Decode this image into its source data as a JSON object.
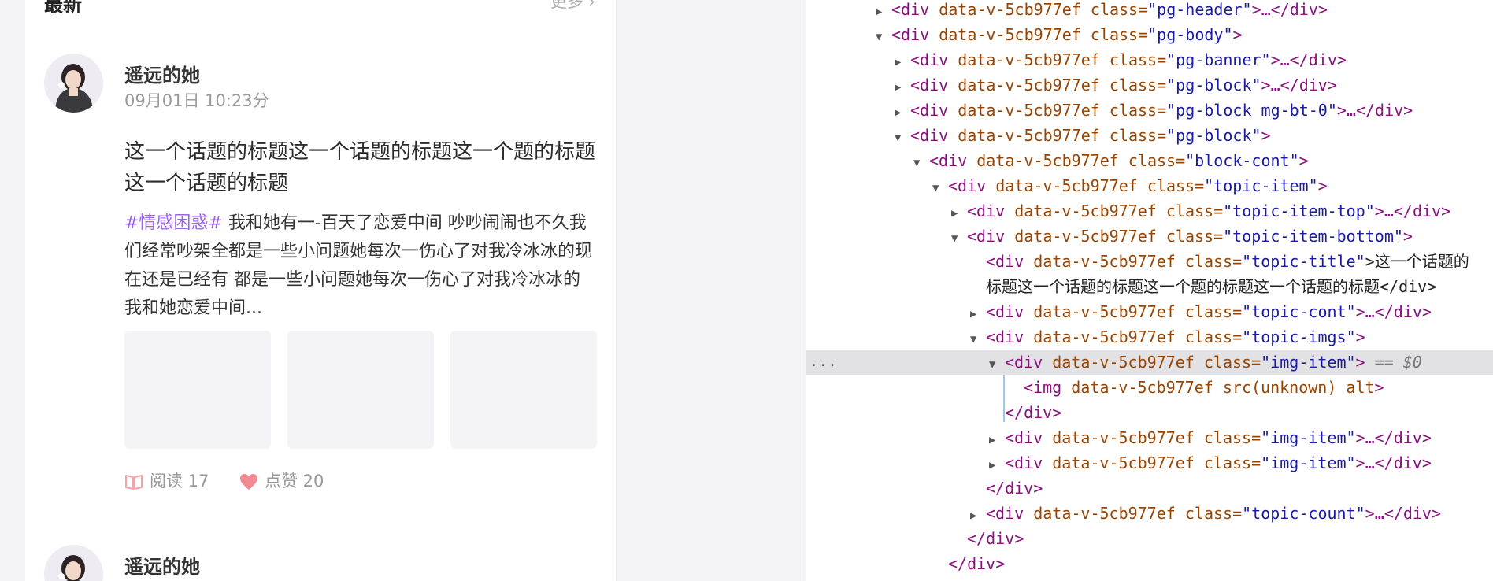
{
  "feed": {
    "section_title": "最新",
    "more_label": "更多 ›",
    "posts": [
      {
        "author": "遥远的她",
        "date": "09月01日 10:23分",
        "title": "这一个话题的标题这一个话题的标题这一个题的标题这一个话题的标题",
        "hashtag": "#情感困惑#",
        "content": " 我和她有一-百天了恋爱中间 吵吵闹闹也不久我们经常吵架全都是一些小问题她每次一伤心了对我冷冰冰的现在还是已经有 都是一些小问题她每次一伤心了对我冷冰冰的我和她恋爱中间...",
        "read_label": "阅读 17",
        "like_label": "点赞 20"
      },
      {
        "author": "遥远的她"
      }
    ]
  },
  "devtools": {
    "lines": [
      {
        "indent": 0,
        "tri": "▶",
        "t": "<div ",
        "a": "data-v-5cb977ef class=",
        "v": "\"pg-header\"",
        "r": ">…</div>"
      },
      {
        "indent": 0,
        "tri": "▼",
        "t": "<div ",
        "a": "data-v-5cb977ef class=",
        "v": "\"pg-body\"",
        "r": ">"
      },
      {
        "indent": 1,
        "tri": "▶",
        "t": "<div ",
        "a": "data-v-5cb977ef class=",
        "v": "\"pg-banner\"",
        "r": ">…</div>"
      },
      {
        "indent": 1,
        "tri": "▶",
        "t": "<div ",
        "a": "data-v-5cb977ef class=",
        "v": "\"pg-block\"",
        "r": ">…</div>"
      },
      {
        "indent": 1,
        "tri": "▶",
        "t": "<div ",
        "a": "data-v-5cb977ef class=",
        "v": "\"pg-block mg-bt-0\"",
        "r": ">…</div>"
      },
      {
        "indent": 1,
        "tri": "▼",
        "t": "<div ",
        "a": "data-v-5cb977ef class=",
        "v": "\"pg-block\"",
        "r": ">"
      },
      {
        "indent": 2,
        "tri": "▼",
        "t": "<div ",
        "a": "data-v-5cb977ef class=",
        "v": "\"block-cont\"",
        "r": ">"
      },
      {
        "indent": 3,
        "tri": "▼",
        "t": "<div ",
        "a": "data-v-5cb977ef class=",
        "v": "\"topic-item\"",
        "r": ">"
      },
      {
        "indent": 4,
        "tri": "▶",
        "t": "<div ",
        "a": "data-v-5cb977ef class=",
        "v": "\"topic-item-top\"",
        "r": ">…</div>"
      },
      {
        "indent": 4,
        "tri": "▼",
        "t": "<div ",
        "a": "data-v-5cb977ef class=",
        "v": "\"topic-item-bottom\"",
        "r": ">"
      },
      {
        "indent": 5,
        "tri": "",
        "t": "<div ",
        "a": "data-v-5cb977ef class=",
        "v": "\"topic-title\"",
        "r": ">这一个话题的"
      },
      {
        "indent": 5,
        "tri": "",
        "t": "",
        "a": "",
        "v": "",
        "r": "标题这一个话题的标题这一个题的标题这一个话题的标题</div>"
      },
      {
        "indent": 5,
        "tri": "▶",
        "t": "<div ",
        "a": "data-v-5cb977ef class=",
        "v": "\"topic-cont\"",
        "r": ">…</div>"
      },
      {
        "indent": 5,
        "tri": "▼",
        "t": "<div ",
        "a": "data-v-5cb977ef class=",
        "v": "\"topic-imgs\"",
        "r": ">"
      },
      {
        "indent": 6,
        "tri": "▼",
        "t": "<div ",
        "a": "data-v-5cb977ef class=",
        "v": "\"img-item\"",
        "r": ">",
        "sel": " == $0"
      },
      {
        "indent": 7,
        "tri": "",
        "t": "<img ",
        "a": "data-v-5cb977ef src(unknown) alt",
        "v": "",
        "r": ">"
      },
      {
        "indent": 6,
        "tri": "",
        "t": "</div>",
        "a": "",
        "v": "",
        "r": ""
      },
      {
        "indent": 6,
        "tri": "▶",
        "t": "<div ",
        "a": "data-v-5cb977ef class=",
        "v": "\"img-item\"",
        "r": ">…</div>"
      },
      {
        "indent": 6,
        "tri": "▶",
        "t": "<div ",
        "a": "data-v-5cb977ef class=",
        "v": "\"img-item\"",
        "r": ">…</div>"
      },
      {
        "indent": 5,
        "tri": "",
        "t": "</div>",
        "a": "",
        "v": "",
        "r": ""
      },
      {
        "indent": 5,
        "tri": "▶",
        "t": "<div ",
        "a": "data-v-5cb977ef class=",
        "v": "\"topic-count\"",
        "r": ">…</div>"
      },
      {
        "indent": 4,
        "tri": "",
        "t": "</div>",
        "a": "",
        "v": "",
        "r": ""
      },
      {
        "indent": 3,
        "tri": "",
        "t": "</div>",
        "a": "",
        "v": "",
        "r": ""
      },
      {
        "indent": 3,
        "tri": "",
        "t": "</",
        "a": "",
        "v": "",
        "r": ""
      }
    ],
    "selected_index": 14,
    "ellipsis": "..."
  }
}
